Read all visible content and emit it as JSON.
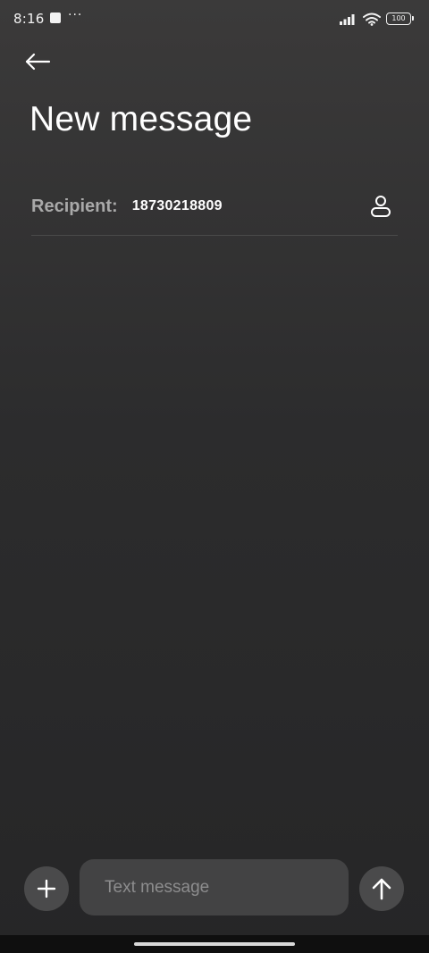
{
  "status_bar": {
    "time": "8:16",
    "more_indicator": "···",
    "battery_level": "100"
  },
  "header": {
    "title": "New message"
  },
  "recipient": {
    "label": "Recipient:",
    "value": "18730218809"
  },
  "composer": {
    "placeholder": "Text message",
    "value": ""
  },
  "colors": {
    "background_top": "#3b3a3a",
    "background_bottom": "#262627",
    "button_fill": "#4a4a4b",
    "input_fill": "#434344",
    "label_gray": "#a9a9a9",
    "text_white": "#ffffff"
  },
  "icons": {
    "back": "arrow-left-icon",
    "contact": "person-icon",
    "add": "plus-icon",
    "send": "arrow-up-icon",
    "signal": "signal-icon",
    "wifi": "wifi-icon",
    "battery": "battery-icon"
  }
}
